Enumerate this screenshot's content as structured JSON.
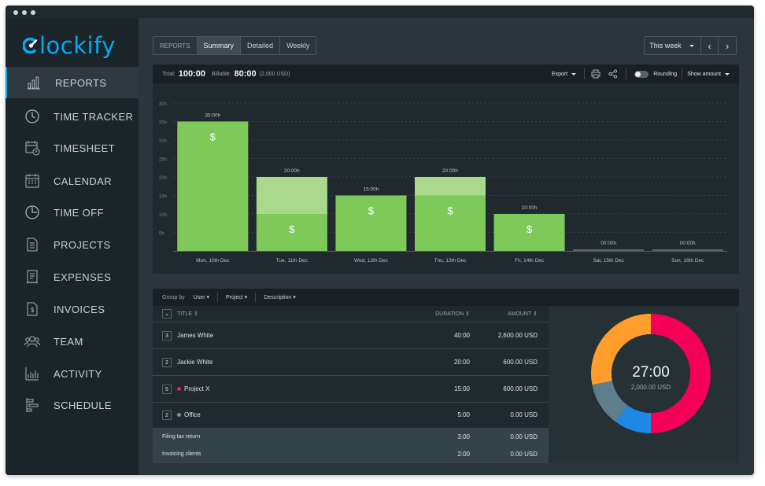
{
  "app": {
    "name": "Clockify",
    "logo_letter_rest": "lockify"
  },
  "sidebar": {
    "items": [
      {
        "label": "REPORTS",
        "icon": "bar-chart-icon",
        "active": true
      },
      {
        "label": "TIME TRACKER",
        "icon": "clock-icon"
      },
      {
        "label": "TIMESHEET",
        "icon": "timesheet-icon"
      },
      {
        "label": "CALENDAR",
        "icon": "calendar-icon"
      },
      {
        "label": "TIME OFF",
        "icon": "time-off-icon"
      },
      {
        "label": "PROJECTS",
        "icon": "document-icon"
      },
      {
        "label": "EXPENSES",
        "icon": "receipt-icon"
      },
      {
        "label": "INVOICES",
        "icon": "invoice-icon"
      },
      {
        "label": "TEAM",
        "icon": "team-icon"
      },
      {
        "label": "ACTIVITY",
        "icon": "activity-icon"
      },
      {
        "label": "SCHEDULE",
        "icon": "schedule-icon"
      }
    ]
  },
  "tabs": {
    "label": "REPORTS",
    "items": [
      "Summary",
      "Detailed",
      "Weekly"
    ],
    "active": "Summary"
  },
  "week": {
    "label": "This week",
    "prev": "‹",
    "next": "›"
  },
  "summary": {
    "total_label": "Total:",
    "total_value": "100:00",
    "billable_label": "Billable:",
    "billable_value": "80:00",
    "billable_amount": "(2,000 USD)",
    "export_label": "Export",
    "rounding_label": "Rounding",
    "show_amount_label": "Show amount"
  },
  "chart_data": {
    "type": "bar",
    "stacked": true,
    "categories": [
      "Mon, 10th Dec",
      "Tue, 11th Dec",
      "Wed, 12th Dec",
      "Thu, 13th Dec",
      "Fri, 14th Dec",
      "Sat, 15th Dec",
      "Sun, 16th Dec"
    ],
    "series": [
      {
        "values": [
          35,
          10,
          15,
          15,
          10,
          0,
          0
        ],
        "color": "#7ec95a"
      },
      {
        "values": [
          0,
          10,
          0,
          5,
          0,
          0,
          0
        ],
        "color": "#a9d98d"
      }
    ],
    "totals_labels": [
      "35:00h",
      "20:00h",
      "15:00h",
      "20:00h",
      "10:00h",
      "00:00h",
      "00:00h"
    ],
    "billable_marker": "$",
    "yticks": [
      "5h",
      "10h",
      "15h",
      "20h",
      "25h",
      "30h",
      "35h",
      "40h"
    ],
    "ylim": [
      0,
      40
    ],
    "grid": true
  },
  "group_by": {
    "label": "Group by",
    "options": [
      "User",
      "Project",
      "Description"
    ]
  },
  "table": {
    "columns": {
      "title": "TITLE",
      "duration": "DURATION",
      "amount": "AMOUNT"
    },
    "rows": [
      {
        "count": "3",
        "title": "James White",
        "duration": "40:00",
        "amount": "2,600.00 USD"
      },
      {
        "count": "2",
        "title": "Jackie White",
        "duration": "20:00",
        "amount": "600.00 USD"
      },
      {
        "count": "5",
        "title": "Project X",
        "duration": "15:00",
        "amount": "600.00 USD",
        "dot": "#e91e63"
      },
      {
        "count": "2",
        "title": "Office",
        "duration": "5:00",
        "amount": "0.00 USD",
        "dot": "#78909c"
      }
    ],
    "subrows": [
      {
        "title": "Filing tax return",
        "duration": "3:00",
        "amount": "0.00 USD"
      },
      {
        "title": "Invoicing clients",
        "duration": "2:00",
        "amount": "0.00 USD"
      }
    ]
  },
  "donut": {
    "center_value": "27:00",
    "center_amount": "2,000.00 USD",
    "segments": [
      {
        "value": 50,
        "color": "#f50057"
      },
      {
        "value": 10,
        "color": "#1e88e5"
      },
      {
        "value": 12,
        "color": "#607d8b"
      },
      {
        "value": 28,
        "color": "#ff9e2c"
      }
    ]
  }
}
